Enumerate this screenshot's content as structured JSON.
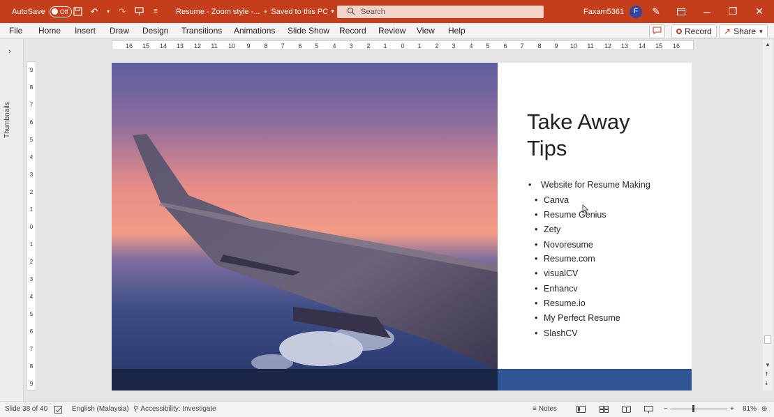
{
  "titlebar": {
    "autosave_label": "AutoSave",
    "autosave_state": "Off",
    "doc_title": "Resume - Zoom style -...",
    "save_status": "Saved to this PC",
    "search_placeholder": "Search",
    "user_name": "Faxam5361",
    "avatar_initial": "F"
  },
  "menu": {
    "items": [
      "File",
      "Home",
      "Insert",
      "Draw",
      "Design",
      "Transitions",
      "Animations",
      "Slide Show",
      "Record",
      "Review",
      "View",
      "Help"
    ],
    "record_label": "Record",
    "share_label": "Share"
  },
  "thumbnails_label": "Thumbnails",
  "slide": {
    "title_line1": "Take Away",
    "title_line2": "Tips",
    "main_bullet": "Website for Resume Making",
    "sub_bullets": [
      "Canva",
      "Resume Genius",
      "Zety",
      "Novoresume",
      "Resume.com",
      "visualCV",
      "Enhancv",
      "Resume.io",
      "My Perfect Resume",
      "SlashCV"
    ]
  },
  "status": {
    "slide_info": "Slide 38 of 40",
    "language": "English (Malaysia)",
    "accessibility": "Accessibility: Investigate",
    "notes_label": "Notes",
    "zoom": "81%"
  },
  "colors": {
    "accent": "#c43e1c",
    "slide_band": "#2f5597"
  }
}
